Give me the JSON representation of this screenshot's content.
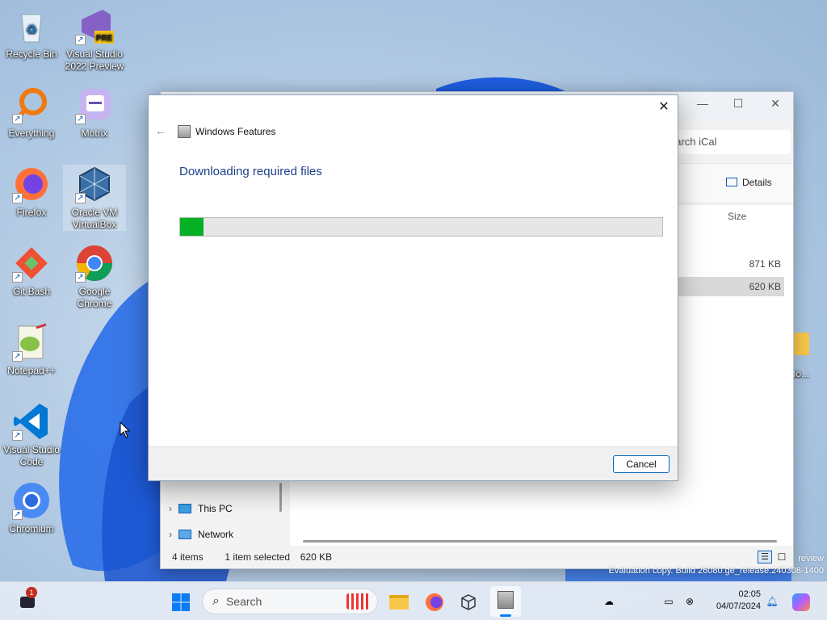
{
  "desktop": {
    "icons": [
      {
        "label": "Recycle Bin",
        "icon": "recycle-bin-icon"
      },
      {
        "label": "Visual Studio 2022 Preview",
        "icon": "visual-studio-icon",
        "badge": "PRE"
      },
      {
        "label": "Everything",
        "icon": "everything-search-icon"
      },
      {
        "label": "Motrix",
        "icon": "motrix-icon"
      },
      {
        "label": "Firefox",
        "icon": "firefox-icon"
      },
      {
        "label": "Oracle VM VirtualBox",
        "icon": "virtualbox-icon"
      },
      {
        "label": "Git Bash",
        "icon": "git-bash-icon"
      },
      {
        "label": "Google Chrome",
        "icon": "chrome-icon"
      },
      {
        "label": "Notepad++",
        "icon": "notepadpp-icon"
      },
      {
        "label": "Visual Studio Code",
        "icon": "vscode-icon"
      },
      {
        "label": "Chromium",
        "icon": "chromium-icon"
      },
      {
        "label": "ndo...",
        "icon": "folder-icon"
      }
    ]
  },
  "explorer": {
    "search_placeholder": "earch iCal",
    "details_label": "Details",
    "size_header": "Size",
    "rows": [
      {
        "size": "871 KB"
      },
      {
        "size": "620 KB"
      }
    ],
    "nav": [
      {
        "label": "This PC"
      },
      {
        "label": "Network"
      }
    ],
    "status": {
      "items": "4 items",
      "selected": "1 item selected",
      "selected_size": "620 KB"
    }
  },
  "dialog": {
    "title": "Windows Features",
    "heading": "Downloading required files",
    "progress": 0.048,
    "cancel_label": "Cancel",
    "progress_color": "#06b025"
  },
  "watermark": {
    "line1": "review",
    "line2": "Evaluation copy. Build 26080.ge_release.240308-1400"
  },
  "taskbar": {
    "search_placeholder": "Search",
    "time": "02:05",
    "date": "04/07/2024",
    "notification_count": "1"
  }
}
